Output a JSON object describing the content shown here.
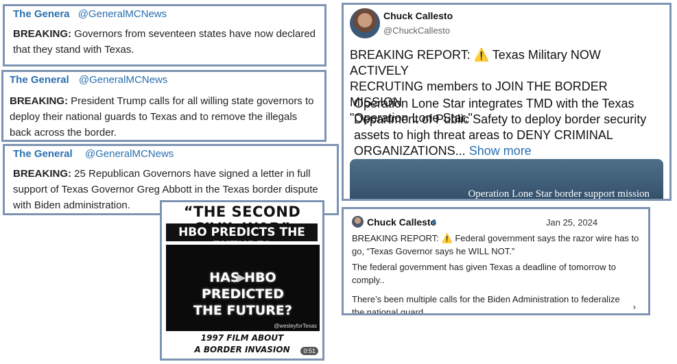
{
  "posts": [
    {
      "name": "The Genera",
      "handle": "@GeneralMCNews",
      "lead": "BREAKING:",
      "lines": [
        "Governors from seventeen states have now declared",
        "that they stand with Texas."
      ]
    },
    {
      "name": "The General",
      "handle": "@GeneralMCNews",
      "lead": "BREAKING:",
      "lines": [
        "President Trump calls for all willing state governors to",
        "deploy their national guards to Texas and to remove the illegals",
        "back across the border."
      ]
    },
    {
      "name": "The General",
      "handle": "@GeneralMCNews",
      "lead": "BREAKING:",
      "lines": [
        "25 Republican Governors have signed a letter in full",
        "support of Texas Governor Greg Abbott in the Texas border dispute",
        "with Biden administration."
      ]
    }
  ],
  "chuck_post": {
    "name": "Chuck Callesto",
    "handle": "@ChuckCallesto",
    "lines": [
      "BREAKING REPORT: ⚠️ Texas Military NOW ACTIVELY",
      "RECRUTING members to JOIN THE BORDER MISSION",
      "\"Operation Lone Star.\""
    ],
    "lines2": [
      "Operation Lone Star integrates TMD with the Texas",
      "Department of Public Safety to deploy border security",
      "assets to high threat areas to DENY CRIMINAL",
      "ORGANIZATIONS..."
    ],
    "show_more": "Show more",
    "media_caption": "Operation Lone Star border support mission"
  },
  "chuck_post2": {
    "name": "Chuck Callesto",
    "date": "Jan 25, 2024",
    "p1": [
      "BREAKING REPORT: ⚠️ Federal government says the razor wire has to",
      "go, “Texas Governor says he WILL NOT.”"
    ],
    "p2": [
      "The federal government has given Texas a deadline of tomorrow to",
      "comply.."
    ],
    "p3": [
      "There’s been multiple calls for the Biden Administration to federalize",
      "the national guard....."
    ],
    "chevron": "›"
  },
  "video": {
    "title": "“THE SECOND CIVIL WAR”",
    "subtitle": "HBO PREDICTS THE FUTURE?",
    "frame_text": [
      "HAS HBO PREDICTED",
      "THE FUTURE?"
    ],
    "watermark": "@wesleyforTexas",
    "bottom": [
      "1997 FILM ABOUT",
      "A BORDER INVASION"
    ],
    "duration": "0:51"
  }
}
